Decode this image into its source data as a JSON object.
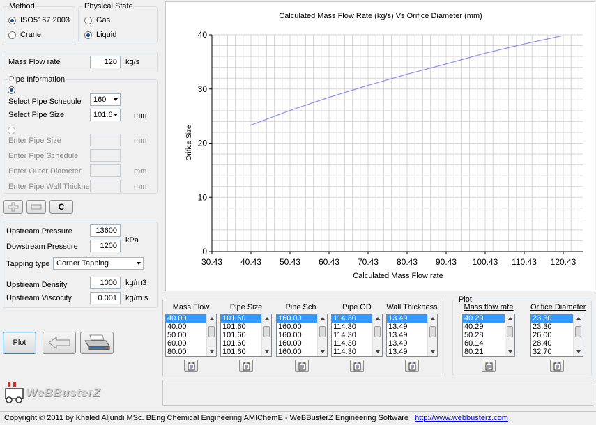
{
  "method": {
    "title": "Method",
    "options": [
      "ISO5167 2003",
      "Crane"
    ],
    "selected": 0
  },
  "state": {
    "title": "Physical State",
    "options": [
      "Gas",
      "Liquid"
    ],
    "selected": 1
  },
  "mass_flow": {
    "label": "Mass Flow rate",
    "value": "120",
    "unit": "kg/s"
  },
  "pipe": {
    "title": "Pipe Information",
    "schedule_label": "Select Pipe Schedule",
    "schedule_value": "160",
    "size_label": "Select Pipe Size",
    "size_value": "101.6",
    "size_unit": "mm",
    "enter_size_label": "Enter Pipe Size",
    "enter_size_unit": "mm",
    "enter_schedule_label": "Enter Pipe Schedule",
    "outer_label": "Enter Outer Diameter",
    "outer_unit": "mm",
    "wall_label": "Enter Pipe Wall Thickness",
    "wall_unit": "mm"
  },
  "clear_label": "C",
  "pressure": {
    "upstream_label": "Upstream Pressure",
    "upstream_value": "13600",
    "downstream_label": "Dowstream Pressure",
    "downstream_value": "1200",
    "unit": "kPa",
    "tapping_label": "Tapping type",
    "tapping_value": "Corner Tapping",
    "density_label": "Upstream Density",
    "density_value": "1000",
    "density_unit": "kg/m3",
    "viscosity_label": "Upstream Viscocity",
    "viscosity_value": "0.001",
    "viscosity_unit": "kg/m s"
  },
  "plot_button": "Plot",
  "logo_text": "WeBBusterZ",
  "chart_data": {
    "type": "line",
    "title": "Calculated Mass Flow Rate (kg/s) Vs Orifice Diameter (mm)",
    "xlabel": "Calculated Mass Flow rate",
    "ylabel": "Orifice Size",
    "xlim": [
      30.43,
      125.43
    ],
    "ylim": [
      0,
      40
    ],
    "x_ticks": [
      "30.43",
      "40.43",
      "50.43",
      "60.43",
      "70.43",
      "80.43",
      "90.43",
      "100.43",
      "110.43",
      "120.43"
    ],
    "y_ticks": [
      "0",
      "10",
      "20",
      "30",
      "40"
    ],
    "grid": true,
    "series": [
      {
        "color": "#8c8cf0",
        "x": [
          40.29,
          50.28,
          60.14,
          70.1,
          80.21,
          90.3,
          100.4,
          110.4,
          120.0
        ],
        "y": [
          23.3,
          26.0,
          28.4,
          30.6,
          32.7,
          34.6,
          36.6,
          38.3,
          39.8
        ]
      }
    ]
  },
  "table": {
    "columns": [
      {
        "header": "Mass Flow",
        "values": [
          "40.00",
          "40.00",
          "50.00",
          "60.00",
          "80.00"
        ]
      },
      {
        "header": "Pipe Size",
        "values": [
          "101.60",
          "101.60",
          "101.60",
          "101.60",
          "101.60"
        ]
      },
      {
        "header": "Pipe Sch.",
        "values": [
          "160.00",
          "160.00",
          "160.00",
          "160.00",
          "160.00"
        ]
      },
      {
        "header": "Pipe OD",
        "values": [
          "114.30",
          "114.30",
          "114.30",
          "114.30",
          "114.30"
        ]
      },
      {
        "header": "Wall Thickness",
        "values": [
          "13.49",
          "13.49",
          "13.49",
          "13.49",
          "13.49"
        ]
      }
    ]
  },
  "plot_group": {
    "title": "Plot",
    "columns": [
      {
        "header": "Mass flow rate",
        "values": [
          "40.29",
          "40.29",
          "50.28",
          "60.14",
          "80.21"
        ]
      },
      {
        "header": "Orifice Diameter",
        "values": [
          "23.30",
          "23.30",
          "26.00",
          "28.40",
          "32.70"
        ]
      }
    ]
  },
  "status": {
    "text": "Copyright © 2011 by Khaled Aljundi MSc. BEng Chemical Engineering AMIChemE   - WeBBusterZ Engineering Software",
    "link": "http://www.webbusterz.com"
  }
}
